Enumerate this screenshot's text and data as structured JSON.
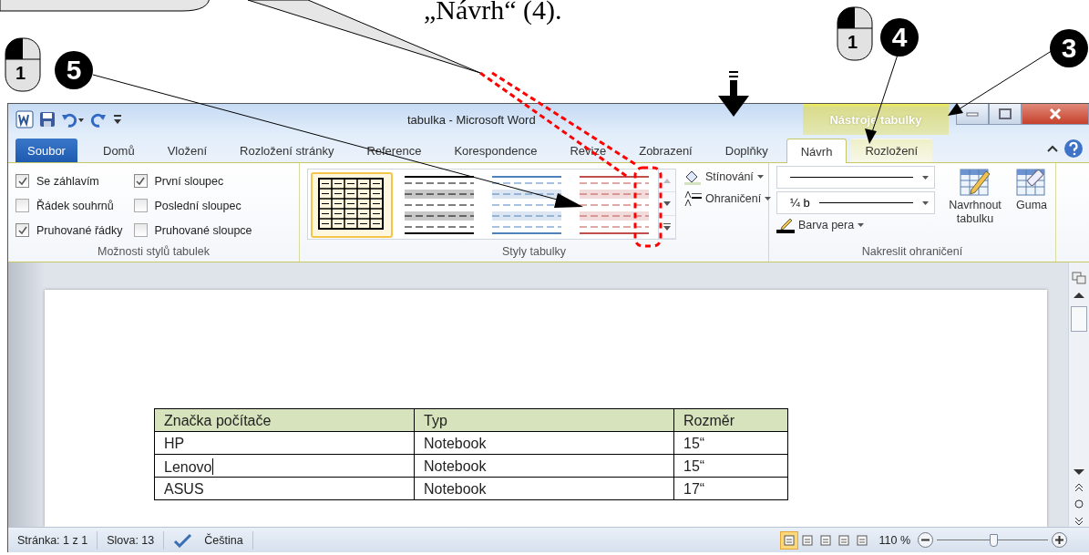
{
  "annotation": {
    "caption": "„Návrh“ (4).",
    "step_numbers": [
      "5",
      "4",
      "3"
    ],
    "mouse_buttons": [
      "1",
      "1"
    ]
  },
  "window": {
    "title": "tabulka  -  Microsoft Word",
    "context_group": "Nástroje tabulky"
  },
  "tabs": [
    {
      "label": "Soubor",
      "kind": "file",
      "selected": false
    },
    {
      "label": "Domů",
      "kind": "tab",
      "selected": false
    },
    {
      "label": "Vložení",
      "kind": "tab",
      "selected": false
    },
    {
      "label": "Rozložení stránky",
      "kind": "tab",
      "selected": false
    },
    {
      "label": "Reference",
      "kind": "tab",
      "selected": false
    },
    {
      "label": "Korespondence",
      "kind": "tab",
      "selected": false
    },
    {
      "label": "Revize",
      "kind": "tab",
      "selected": false
    },
    {
      "label": "Zobrazení",
      "kind": "tab",
      "selected": false
    },
    {
      "label": "Doplňky",
      "kind": "tab",
      "selected": false
    },
    {
      "label": "Návrh",
      "kind": "context",
      "selected": true
    },
    {
      "label": "Rozložení",
      "kind": "context",
      "selected": false
    }
  ],
  "ribbon": {
    "style_options": {
      "label": "Možnosti stylů tabulek",
      "checkboxes": [
        {
          "label": "Se záhlavím",
          "checked": true
        },
        {
          "label": "Řádek souhrnů",
          "checked": false
        },
        {
          "label": "Pruhované řádky",
          "checked": true
        },
        {
          "label": "První sloupec",
          "checked": true
        },
        {
          "label": "Poslední sloupec",
          "checked": false
        },
        {
          "label": "Pruhované sloupce",
          "checked": false
        }
      ]
    },
    "table_styles": {
      "label": "Styly tabulky",
      "gallery": [
        {
          "kind": "grid",
          "color": "#000000",
          "selected": true
        },
        {
          "kind": "banded",
          "color": "#000000",
          "selected": false
        },
        {
          "kind": "banded",
          "color": "#4f81bd",
          "selected": false
        },
        {
          "kind": "banded",
          "color": "#c0504d",
          "selected": false
        }
      ],
      "buttons": [
        "Stínování",
        "Ohraničení"
      ]
    },
    "draw_borders": {
      "label": "Nakreslit ohraničení",
      "line_weight": "¼ b",
      "pen_color": "Barva pera",
      "buttons": [
        "Navrhnout tabulku",
        "Guma"
      ]
    }
  },
  "document": {
    "table": {
      "columns": [
        "Značka počítače",
        "Typ",
        "Rozměr"
      ],
      "rows": [
        {
          "cells": [
            "HP",
            "Notebook",
            "15“"
          ],
          "caret": false
        },
        {
          "cells": [
            "Lenovo",
            "Notebook",
            "15“"
          ],
          "caret": true
        },
        {
          "cells": [
            "ASUS",
            "Notebook",
            "17“"
          ],
          "caret": false
        }
      ]
    }
  },
  "status_bar": {
    "page": "Stránka: 1 z 1",
    "words": "Slova: 13",
    "language": "Čeština",
    "zoom": "110 %",
    "zoom_slider": {
      "level": 0.52
    },
    "views": [
      {
        "selected": true
      },
      {
        "selected": false
      },
      {
        "selected": false
      },
      {
        "selected": false
      },
      {
        "selected": false
      }
    ]
  }
}
